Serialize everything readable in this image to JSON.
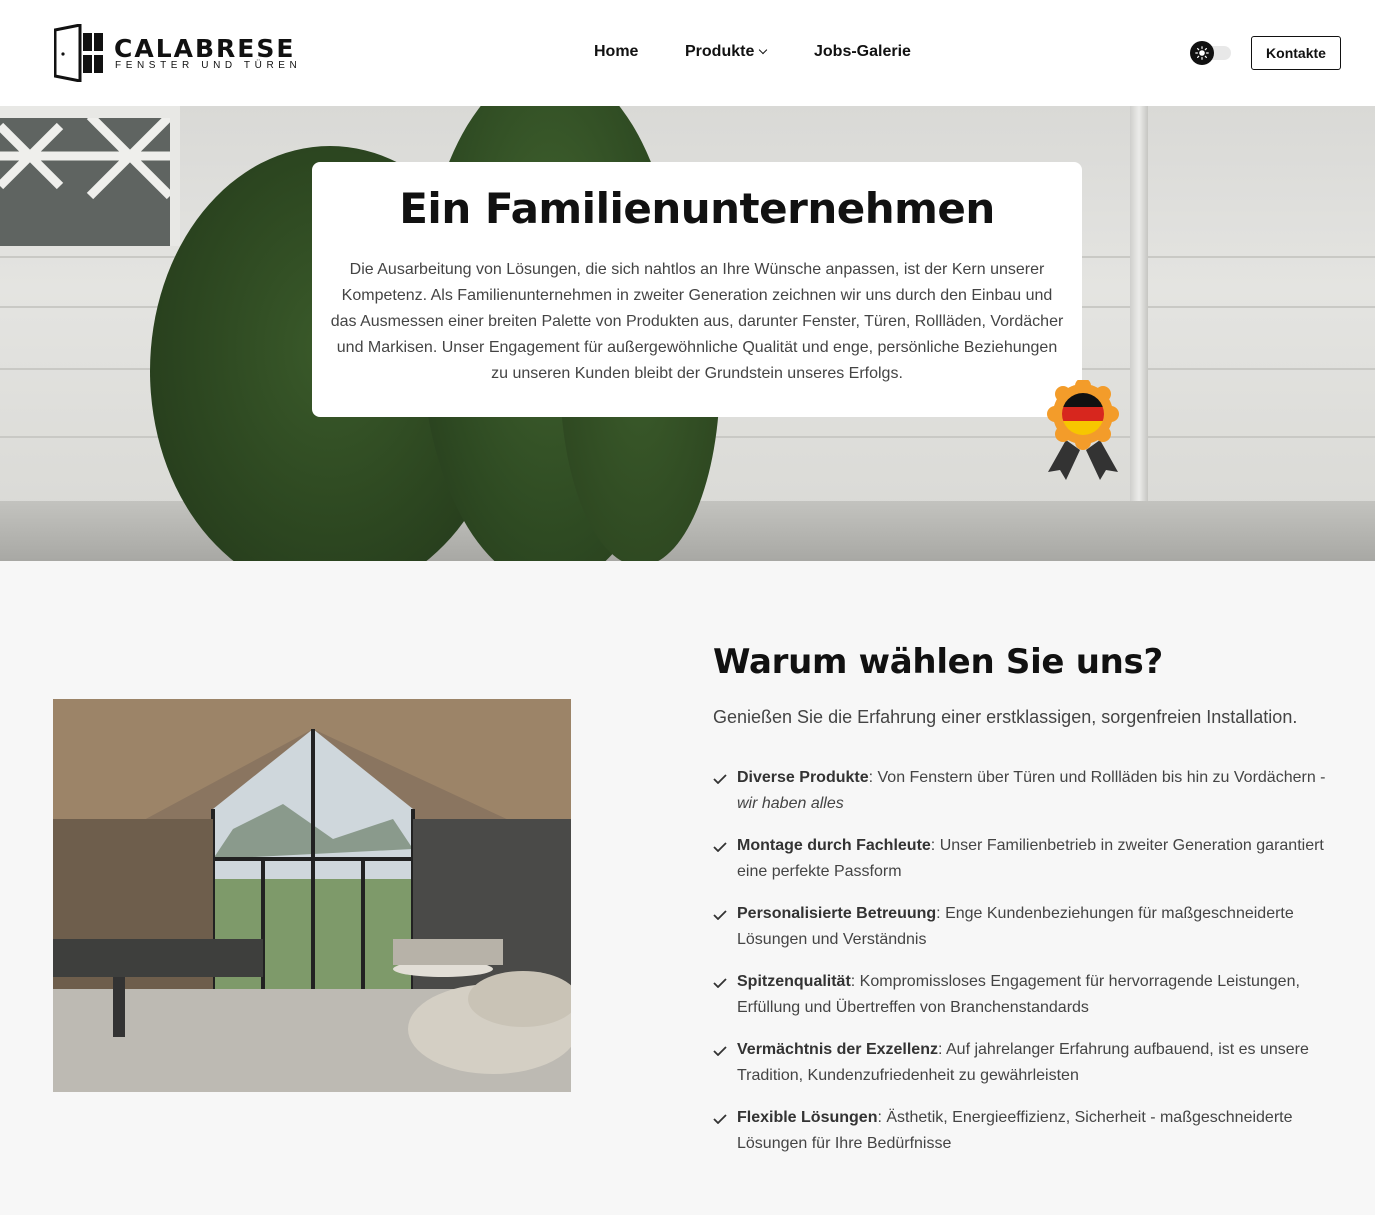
{
  "header": {
    "logo_name": "CALABRESE",
    "logo_subtitle": "FENSTER UND TÜREN",
    "nav": [
      {
        "label": "Home"
      },
      {
        "label": "Produkte"
      },
      {
        "label": "Jobs-Galerie"
      }
    ],
    "contact_label": "Kontakte",
    "theme_icon": "sun-icon"
  },
  "hero": {
    "title": "Ein Familienunternehmen",
    "text": "Die Ausarbeitung von Lösungen, die sich nahtlos an Ihre Wünsche anpassen, ist der Kern unserer Kompetenz. Als Familienunternehmen in zweiter Generation zeichnen wir uns durch den Einbau und das Ausmessen einer breiten Palette von Produkten aus, darunter Fenster, Türen, Rollläden, Vordächer und Markisen. Unser Engagement für außergewöhnliche Qualität und enge, persönliche Beziehungen zu unseren Kunden bleibt der Grundstein unseres Erfolgs.",
    "badge_icon": "german-flag-award-icon"
  },
  "why": {
    "title": "Warum wählen Sie uns?",
    "subtitle": "Genießen Sie die Erfahrung einer erstklassigen, sorgenfreien Installation.",
    "items": [
      {
        "bold": "Diverse Produkte",
        "text": ": Von Fenstern über Türen und Rollläden bis hin zu Vordächern - ",
        "italic": "wir haben alles"
      },
      {
        "bold": "Montage durch Fachleute",
        "text": ": Unser Familienbetrieb in zweiter Generation garantiert eine perfekte Passform",
        "italic": ""
      },
      {
        "bold": "Personalisierte Betreuung",
        "text": ": Enge Kundenbeziehungen für maßgeschneiderte Lösungen und Verständnis",
        "italic": ""
      },
      {
        "bold": "Spitzenqualität",
        "text": ": Kompromissloses Engagement für hervorragende Leistungen, Erfüllung und Übertreffen von Branchenstandards",
        "italic": ""
      },
      {
        "bold": "Vermächtnis der Exzellenz",
        "text": ": Auf jahrelanger Erfahrung aufbauend, ist es unsere Tradition, Kundenzufriedenheit zu gewährleisten",
        "italic": ""
      },
      {
        "bold": "Flexible Lösungen",
        "text": ": Ästhetik, Energieeffizienz, Sicherheit - maßgeschneiderte Lösungen für Ihre Bedürfnisse",
        "italic": ""
      }
    ]
  },
  "colors": {
    "accent": "#111111",
    "background": "#f7f7f7",
    "badge_orange": "#f39c2a"
  }
}
